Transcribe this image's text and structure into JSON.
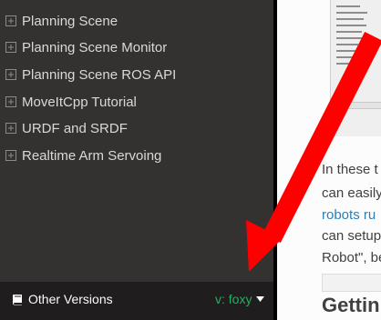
{
  "sidebar": {
    "items": [
      {
        "label": "Planning Scene"
      },
      {
        "label": "Planning Scene Monitor"
      },
      {
        "label": "Planning Scene ROS API"
      },
      {
        "label": "MoveItCpp Tutorial"
      },
      {
        "label": "URDF and SRDF"
      },
      {
        "label": "Realtime Arm Servoing"
      }
    ]
  },
  "versions": {
    "label": "Other Versions",
    "current": "v: foxy",
    "book_icon": "book-icon",
    "caret_icon": "caret-down-icon"
  },
  "content": {
    "lines": [
      {
        "text": "In these t",
        "link": false
      },
      {
        "text": "can easily",
        "link": false
      },
      {
        "text": "robots ru",
        "link": true
      },
      {
        "text": "can setup",
        "link": false
      },
      {
        "text": "Robot\", be",
        "link": false
      }
    ],
    "heading": "Gettin"
  },
  "colors": {
    "sidebar_bg": "#343131",
    "version_bar_bg": "#1f1d1d",
    "version_current": "#27ae60",
    "link": "#2980b9",
    "annotation_arrow": "#ff0000"
  }
}
